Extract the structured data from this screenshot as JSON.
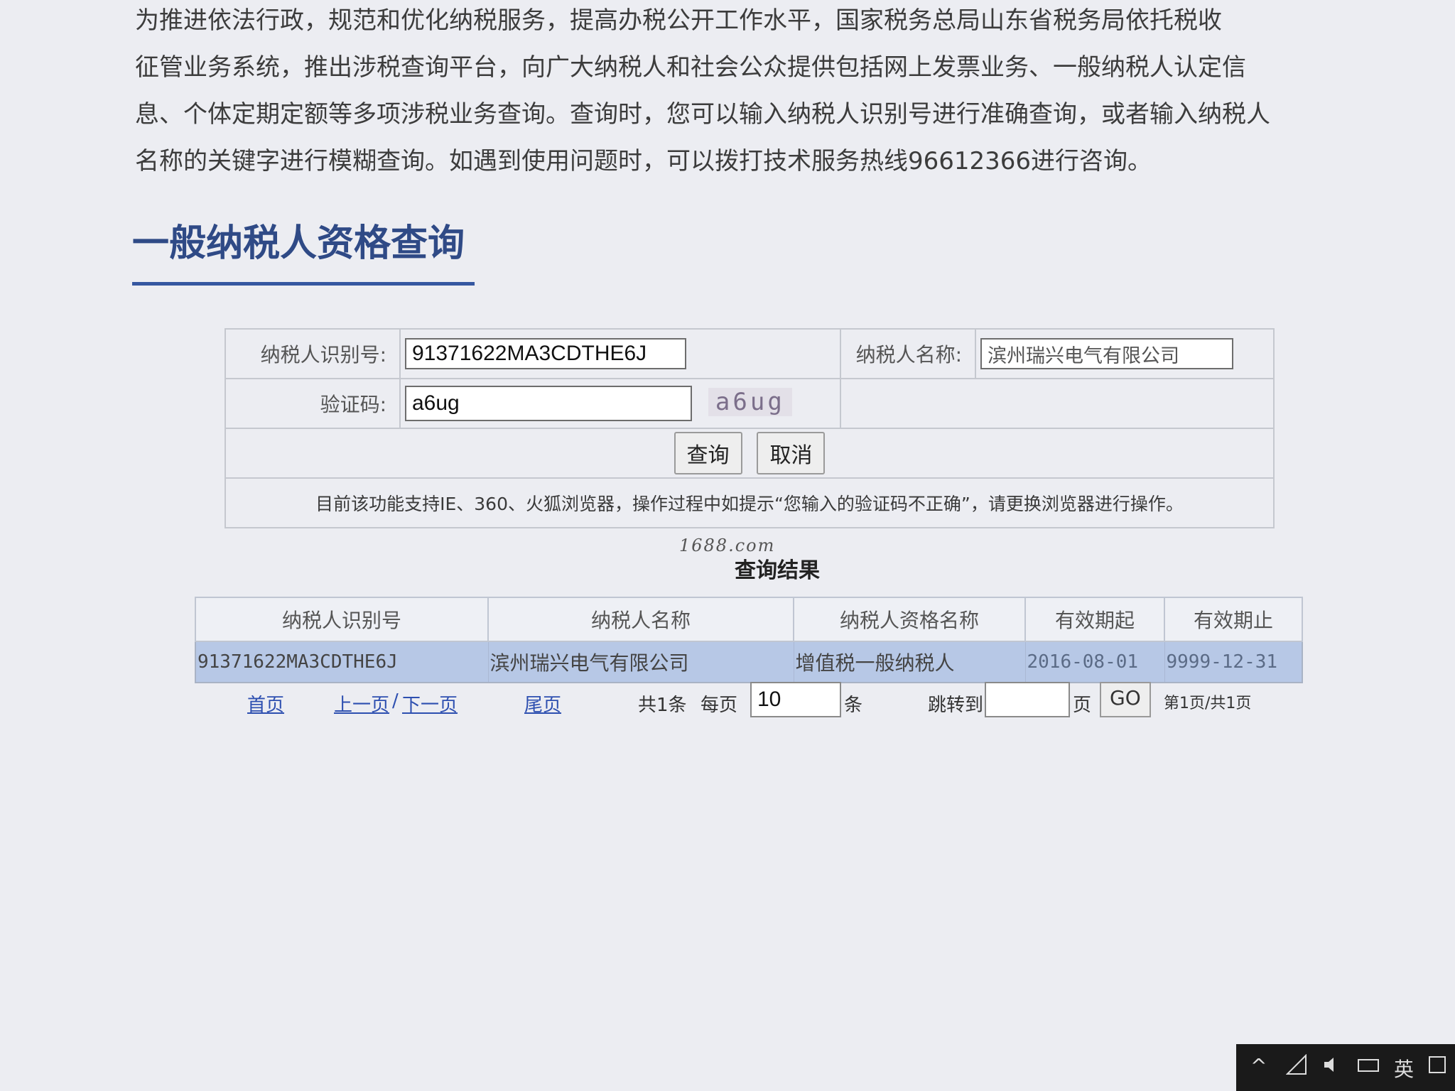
{
  "intro": {
    "line1": "为推进依法行政，规范和优化纳税服务，提高办税公开工作水平，国家税务总局山东省税务局依托税收",
    "line2": "征管业务系统，推出涉税查询平台，向广大纳税人和社会公众提供包括网上发票业务、一般纳税人认定信",
    "line3": "息、个体定期定额等多项涉税业务查询。查询时，您可以输入纳税人识别号进行准确查询，或者输入纳税人",
    "line4": "名称的关键字进行模糊查询。如遇到使用问题时，可以拨打技术服务热线96612366进行咨询。"
  },
  "section_title": "一般纳税人资格查询",
  "form": {
    "taxpayer_id_label": "纳税人识别号:",
    "taxpayer_id_value": "91371622MA3CDTHE6J",
    "taxpayer_name_label": "纳税人名称:",
    "taxpayer_name_value": "滨州瑞兴电气有限公司",
    "captcha_label": "验证码:",
    "captcha_value": "a6ug",
    "captcha_image_text": "a6ug",
    "query_button": "查询",
    "cancel_button": "取消",
    "notice": "目前该功能支持IE、360、火狐浏览器，操作过程中如提示“您输入的验证码不正确”，请更换浏览器进行操作。"
  },
  "watermark": "1688.com",
  "results": {
    "title": "查询结果",
    "headers": [
      "纳税人识别号",
      "纳税人名称",
      "纳税人资格名称",
      "有效期起",
      "有效期止"
    ],
    "rows": [
      [
        "91371622MA3CDTHE6J",
        "滨州瑞兴电气有限公司",
        "增值税一般纳税人",
        "2016-08-01",
        "9999-12-31"
      ]
    ]
  },
  "pager": {
    "first": "首页",
    "prev": "上一页",
    "sep": "/",
    "next": "下一页",
    "last": "尾页",
    "total": "共1条",
    "per_page_label": "每页",
    "per_page_value": "10",
    "per_page_unit": "条",
    "jump_label": "跳转到",
    "jump_value": "",
    "jump_unit": "页",
    "go_button": "GO",
    "page_info": "第1页/共1页"
  },
  "tray": {
    "chevron": "^",
    "ime": "英"
  }
}
